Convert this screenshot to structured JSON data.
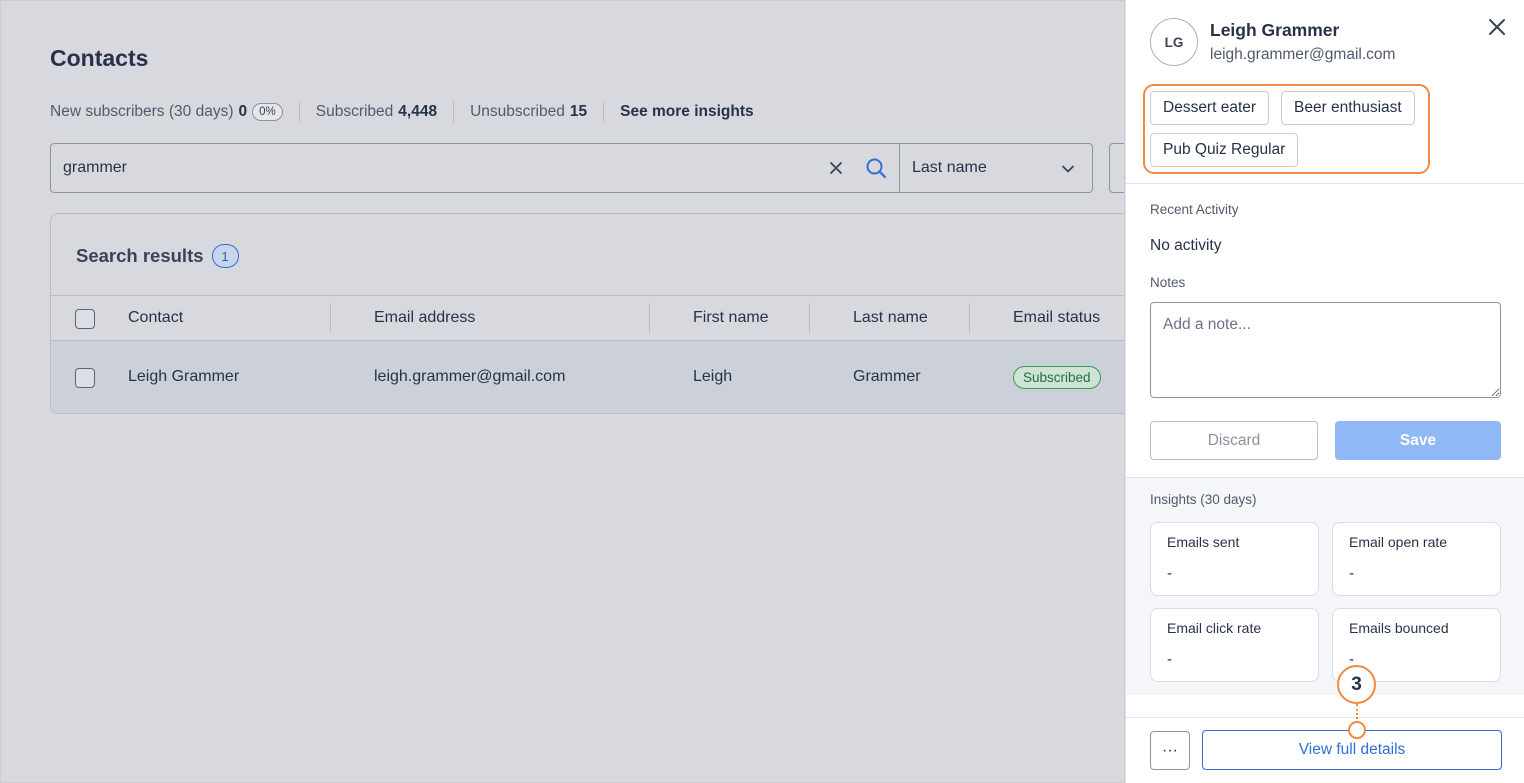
{
  "main": {
    "title": "Contacts",
    "insights": {
      "new_label": "New subscribers (30 days)",
      "new_value": "0",
      "new_pct": "0%",
      "subscribed_label": "Subscribed",
      "subscribed_value": "4,448",
      "unsubscribed_label": "Unsubscribed",
      "unsubscribed_value": "15",
      "see_more": "See more insights"
    },
    "search": {
      "value": "grammer",
      "sort_by": "Last name"
    },
    "results": {
      "title": "Search results",
      "count": "1",
      "columns": [
        "Contact",
        "Email address",
        "First name",
        "Last name",
        "Email status"
      ],
      "rows": [
        {
          "contact": "Leigh Grammer",
          "email": "leigh.grammer@gmail.com",
          "first_name": "Leigh",
          "last_name": "Grammer",
          "status": "Subscribed"
        }
      ]
    }
  },
  "panel": {
    "initials": "LG",
    "name": "Leigh Grammer",
    "email": "leigh.grammer@gmail.com",
    "tags": [
      "Dessert eater",
      "Beer enthusiast",
      "Pub Quiz Regular"
    ],
    "recent_activity_label": "Recent Activity",
    "recent_activity_value": "No activity",
    "notes_label": "Notes",
    "notes_placeholder": "Add a note...",
    "discard_label": "Discard",
    "save_label": "Save",
    "insights_label": "Insights (30 days)",
    "insights": [
      {
        "label": "Emails sent",
        "value": "-"
      },
      {
        "label": "Email open rate",
        "value": "-"
      },
      {
        "label": "Email click rate",
        "value": "-"
      },
      {
        "label": "Emails bounced",
        "value": "-"
      }
    ],
    "step_marker": "3",
    "more_label": "···",
    "view_details_label": "View full details"
  },
  "colors": {
    "accent": "#2f6fd6",
    "highlight": "#f08a40",
    "success": "#3a9a5b"
  }
}
